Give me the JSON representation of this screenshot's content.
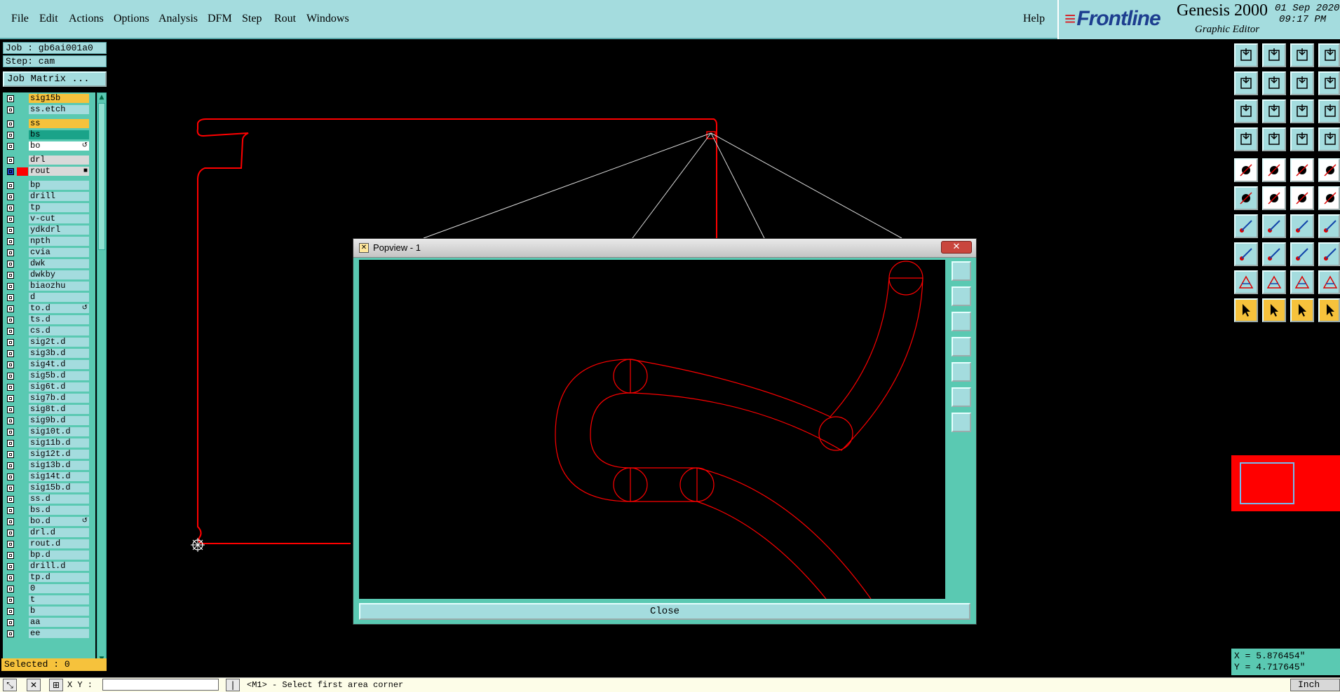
{
  "menu": {
    "items": [
      "File",
      "Edit",
      "Actions",
      "Options",
      "Analysis",
      "DFM",
      "Step",
      "Rout",
      "Windows"
    ],
    "help": "Help"
  },
  "brand": {
    "logo": "Frontline",
    "product": "Genesis 2000",
    "editor": "Graphic Editor",
    "date": "01 Sep 2020",
    "time": "09:17 PM"
  },
  "job": {
    "job_label": "Job : gb6ai001a0",
    "step_label": "Step: cam",
    "matrix_button": "Job Matrix ...",
    "selected": "Selected : 0"
  },
  "layers": [
    {
      "name": "sig15b",
      "color": "#f6c23c",
      "mark": ""
    },
    {
      "name": "ss.etch",
      "color": "#a4dcde",
      "mark": ""
    },
    {
      "name": "ss",
      "color": "#f6c23c",
      "mark": ""
    },
    {
      "name": "bs",
      "color": "#1aa389",
      "mark": ""
    },
    {
      "name": "bo",
      "color": "#ffffff",
      "mark": "↺"
    },
    {
      "name": "drl",
      "color": "#d9d9d9",
      "mark": ""
    },
    {
      "name": "rout",
      "color": "#d9d9d9",
      "mark": "■",
      "swatch": "#ff0000",
      "active": true
    },
    {
      "name": "bp",
      "color": "#a4dcde",
      "mark": ""
    },
    {
      "name": "drill",
      "color": "#a4dcde",
      "mark": ""
    },
    {
      "name": "tp",
      "color": "#a4dcde",
      "mark": ""
    },
    {
      "name": "v-cut",
      "color": "#a4dcde",
      "mark": ""
    },
    {
      "name": "ydkdrl",
      "color": "#a4dcde",
      "mark": ""
    },
    {
      "name": "npth",
      "color": "#a4dcde",
      "mark": ""
    },
    {
      "name": "cvia",
      "color": "#a4dcde",
      "mark": ""
    },
    {
      "name": "dwk",
      "color": "#a4dcde",
      "mark": ""
    },
    {
      "name": "dwkby",
      "color": "#a4dcde",
      "mark": ""
    },
    {
      "name": "biaozhu",
      "color": "#a4dcde",
      "mark": ""
    },
    {
      "name": "d",
      "color": "#a4dcde",
      "mark": ""
    },
    {
      "name": "to.d",
      "color": "#a4dcde",
      "mark": "↺"
    },
    {
      "name": "ts.d",
      "color": "#a4dcde",
      "mark": ""
    },
    {
      "name": "cs.d",
      "color": "#a4dcde",
      "mark": ""
    },
    {
      "name": "sig2t.d",
      "color": "#a4dcde",
      "mark": ""
    },
    {
      "name": "sig3b.d",
      "color": "#a4dcde",
      "mark": ""
    },
    {
      "name": "sig4t.d",
      "color": "#a4dcde",
      "mark": ""
    },
    {
      "name": "sig5b.d",
      "color": "#a4dcde",
      "mark": ""
    },
    {
      "name": "sig6t.d",
      "color": "#a4dcde",
      "mark": ""
    },
    {
      "name": "sig7b.d",
      "color": "#a4dcde",
      "mark": ""
    },
    {
      "name": "sig8t.d",
      "color": "#a4dcde",
      "mark": ""
    },
    {
      "name": "sig9b.d",
      "color": "#a4dcde",
      "mark": ""
    },
    {
      "name": "sig10t.d",
      "color": "#a4dcde",
      "mark": ""
    },
    {
      "name": "sig11b.d",
      "color": "#a4dcde",
      "mark": ""
    },
    {
      "name": "sig12t.d",
      "color": "#a4dcde",
      "mark": ""
    },
    {
      "name": "sig13b.d",
      "color": "#a4dcde",
      "mark": ""
    },
    {
      "name": "sig14t.d",
      "color": "#a4dcde",
      "mark": ""
    },
    {
      "name": "sig15b.d",
      "color": "#a4dcde",
      "mark": ""
    },
    {
      "name": "ss.d",
      "color": "#a4dcde",
      "mark": ""
    },
    {
      "name": "bs.d",
      "color": "#a4dcde",
      "mark": ""
    },
    {
      "name": "bo.d",
      "color": "#a4dcde",
      "mark": "↺"
    },
    {
      "name": "drl.d",
      "color": "#a4dcde",
      "mark": ""
    },
    {
      "name": "rout.d",
      "color": "#a4dcde",
      "mark": ""
    },
    {
      "name": "bp.d",
      "color": "#a4dcde",
      "mark": ""
    },
    {
      "name": "drill.d",
      "color": "#a4dcde",
      "mark": ""
    },
    {
      "name": "tp.d",
      "color": "#a4dcde",
      "mark": ""
    },
    {
      "name": "0",
      "color": "#a4dcde",
      "mark": ""
    },
    {
      "name": "t",
      "color": "#a4dcde",
      "mark": ""
    },
    {
      "name": "b",
      "color": "#a4dcde",
      "mark": ""
    },
    {
      "name": "aa",
      "color": "#a4dcde",
      "mark": ""
    },
    {
      "name": "ee",
      "color": "#a4dcde",
      "mark": ""
    }
  ],
  "popview": {
    "title": "Popview - 1",
    "close_label": "Close"
  },
  "status": {
    "xy_label": "X Y :",
    "message": "<M1> - Select first area corner",
    "unit": "Inch"
  },
  "coords": {
    "x": "X = 5.876454\"",
    "y": "Y = 4.717645\""
  },
  "colors": {
    "accent": "#a4dcde",
    "panel": "#5ac9b2",
    "highlight": "#f6c23c",
    "rout": "#ff0000"
  }
}
